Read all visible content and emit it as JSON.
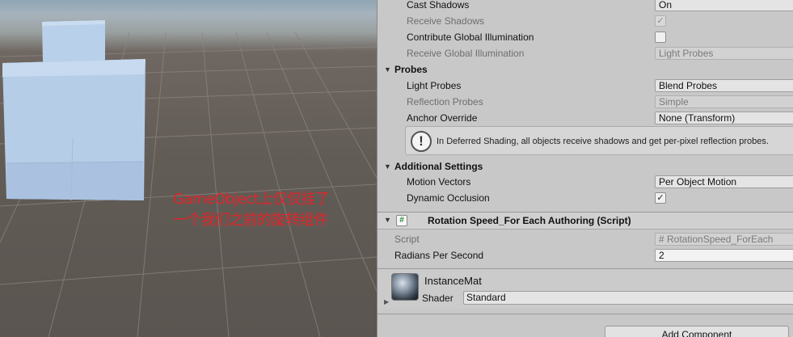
{
  "scene": {
    "annotation_line1": "GameObject上仅仅挂了",
    "annotation_line2": "一个我们之前的旋转组件",
    "annotation_color": "#e0262a"
  },
  "inspector": {
    "lighting_rows": [
      {
        "label": "Cast Shadows",
        "value": "On",
        "kind": "dropdown",
        "disabled": false
      },
      {
        "label": "Receive Shadows",
        "value": "✓",
        "kind": "checkbox",
        "disabled": true
      },
      {
        "label": "Contribute Global Illumination",
        "value": "",
        "kind": "checkbox",
        "disabled": false
      },
      {
        "label": "Receive Global Illumination",
        "value": "Light Probes",
        "kind": "dropdown",
        "disabled": true
      }
    ],
    "probes": {
      "title": "Probes",
      "light_probes_label": "Light Probes",
      "light_probes_value": "Blend Probes",
      "reflection_probes_label": "Reflection Probes",
      "reflection_probes_value": "Simple",
      "anchor_override_label": "Anchor Override",
      "anchor_override_value": "None (Transform)",
      "help_icon": "!",
      "help_text": "In Deferred Shading, all objects receive shadows and get per-pixel reflection probes."
    },
    "additional": {
      "title": "Additional Settings",
      "motion_vectors_label": "Motion Vectors",
      "motion_vectors_value": "Per Object Motion",
      "dynamic_occlusion_label": "Dynamic Occlusion",
      "dynamic_occlusion_value": "✓"
    },
    "component": {
      "icon": "#",
      "title": "Rotation Speed_For Each Authoring (Script)",
      "script_label": "Script",
      "script_value": "# RotationSpeed_ForEach",
      "radians_label": "Radians Per Second",
      "radians_value": "2"
    },
    "material": {
      "name": "InstanceMat",
      "shader_label": "Shader",
      "shader_value": "Standard"
    },
    "add_component_label": "Add Component"
  }
}
